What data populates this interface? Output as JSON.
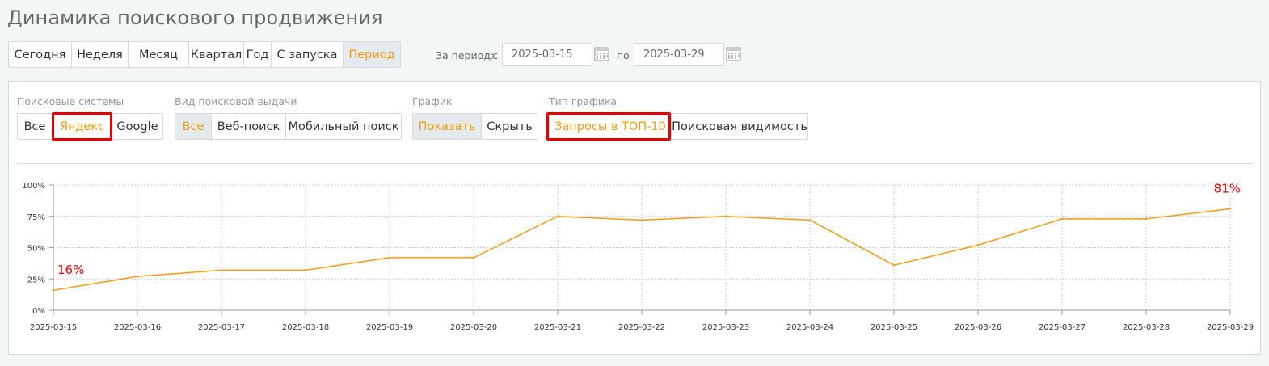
{
  "page": {
    "title": "Динамика поискового продвижения"
  },
  "period_bar": {
    "buttons": [
      "Сегодня",
      "Неделя",
      "Месяц",
      "Квартал",
      "Год",
      "С запуска",
      "Период"
    ],
    "active_index": 6
  },
  "date_range": {
    "label": "За период:",
    "from_label": "с",
    "from_value": "2025-03-15",
    "to_label": "по",
    "to_value": "2025-03-29"
  },
  "filters": {
    "search_engines": {
      "label": "Поисковые системы",
      "options": [
        "Все",
        "Яндекс",
        "Google"
      ],
      "active": "Яндекс"
    },
    "serp_type": {
      "label": "Вид поисковой выдачи",
      "options": [
        "Все",
        "Веб-поиск",
        "Мобильный поиск"
      ],
      "active": "Все"
    },
    "graph": {
      "label": "График",
      "options": [
        "Показать",
        "Скрыть"
      ],
      "active": "Показать"
    },
    "graph_type": {
      "label": "Тип графика",
      "options": [
        "Запросы в ТОП-10",
        "Поисковая видимость"
      ],
      "active": "Запросы в ТОП-10"
    }
  },
  "colors": {
    "accent": "#f39c12",
    "highlight": "#e60000",
    "grid": "#cccccc"
  },
  "chart_data": {
    "type": "line",
    "x": [
      "2025-03-15",
      "2025-03-16",
      "2025-03-17",
      "2025-03-18",
      "2025-03-19",
      "2025-03-20",
      "2025-03-21",
      "2025-03-22",
      "2025-03-23",
      "2025-03-24",
      "2025-03-25",
      "2025-03-26",
      "2025-03-27",
      "2025-03-28",
      "2025-03-29"
    ],
    "series": [
      {
        "values": [
          16,
          27,
          32,
          32,
          42,
          42,
          75,
          72,
          75,
          72,
          36,
          52,
          73,
          73,
          81
        ],
        "color": "#f39c12"
      }
    ],
    "y_ticks": [
      "0%",
      "25%",
      "50%",
      "75%",
      "100%"
    ],
    "ylim": [
      0,
      100
    ],
    "grid": true,
    "data_labels": [
      {
        "index": 0,
        "text": "16%"
      },
      {
        "index": 14,
        "text": "81%"
      }
    ]
  }
}
